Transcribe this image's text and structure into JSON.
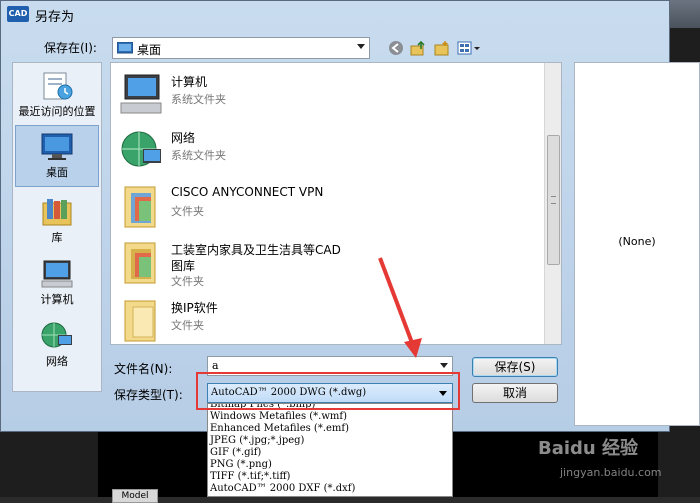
{
  "dialog": {
    "app_badge": "CAD",
    "title": "另存为"
  },
  "save_in": {
    "label": "保存在(I):",
    "value": "桌面"
  },
  "toolbar": {
    "back_icon": "back-arrow-icon",
    "up_icon": "up-folder-icon",
    "new_folder_icon": "new-folder-icon",
    "views_icon": "views-menu-icon"
  },
  "places": [
    {
      "label": "最近访问的位置",
      "icon": "recent-places-icon"
    },
    {
      "label": "桌面",
      "icon": "desktop-icon"
    },
    {
      "label": "库",
      "icon": "libraries-icon"
    },
    {
      "label": "计算机",
      "icon": "computer-icon"
    },
    {
      "label": "网络",
      "icon": "network-icon"
    }
  ],
  "files": [
    {
      "name": "计算机",
      "type": "系统文件夹",
      "icon": "computer-icon"
    },
    {
      "name": "网络",
      "type": "系统文件夹",
      "icon": "network-globe-icon"
    },
    {
      "name": "CISCO ANYCONNECT VPN",
      "type": "文件夹",
      "icon": "folder-icon"
    },
    {
      "name": "工装室内家具及卫生洁具等CAD",
      "name2": "图库",
      "type": "文件夹",
      "icon": "folder-icon"
    },
    {
      "name": "换IP软件",
      "type": "文件夹",
      "icon": "folder-icon"
    }
  ],
  "preview": {
    "text": "(None)"
  },
  "filename": {
    "label": "文件名(N):",
    "value": "a"
  },
  "filetype": {
    "label": "保存类型(T):",
    "selected": "AutoCAD™ 2000 DWG (*.dwg)",
    "options": [
      "Bitmap Files (*.bmp)",
      "Windows Metafiles (*.wmf)",
      "Enhanced Metafiles (*.emf)",
      "JPEG (*.jpg;*.jpeg)",
      "GIF (*.gif)",
      "PNG (*.png)",
      "TIFF (*.tif;*.tiff)",
      "AutoCAD™ 2000 DXF (*.dxf)"
    ]
  },
  "buttons": {
    "save": "保存(S)",
    "cancel": "取消"
  },
  "background": {
    "model_tab": "Model"
  },
  "watermark": {
    "text": "Baidu 经验",
    "url": "jingyan.baidu.com"
  },
  "colors": {
    "highlight_box": "#e53935",
    "accent": "#3c7fb1"
  }
}
